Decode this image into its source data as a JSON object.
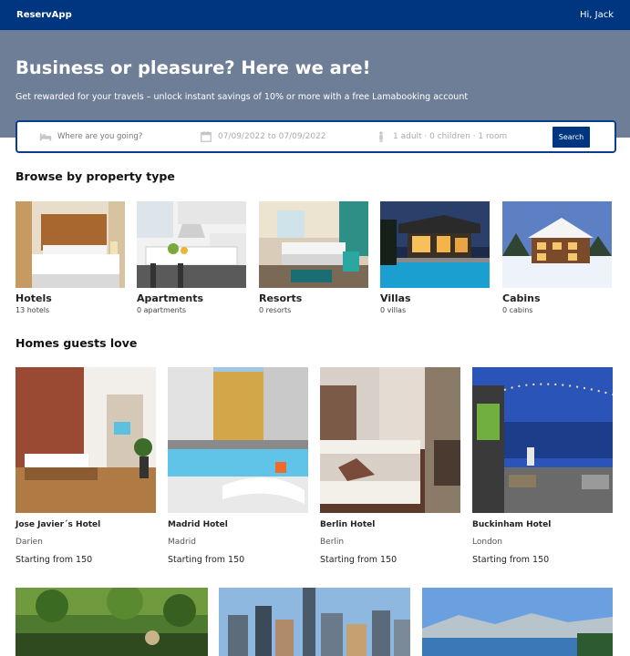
{
  "navbar": {
    "brand": "ReservApp",
    "greeting": "Hi, Jack"
  },
  "hero": {
    "title": "Business or pleasure? Here we are!",
    "subtitle": "Get rewarded for your travels – unlock instant savings of 10% or more with a free Lamabooking account"
  },
  "search": {
    "destination_placeholder": "Where are you going?",
    "dates": "07/09/2022 to 07/09/2022",
    "guests": "1 adult · 0 children · 1 room",
    "button": "Search"
  },
  "sections": {
    "browse_title": "Browse by property type",
    "homes_title": "Homes guests love"
  },
  "property_types": [
    {
      "title": "Hotels",
      "count": "13 hotels"
    },
    {
      "title": "Apartments",
      "count": "0 apartments"
    },
    {
      "title": "Resorts",
      "count": "0 resorts"
    },
    {
      "title": "Villas",
      "count": "0 villas"
    },
    {
      "title": "Cabins",
      "count": "0 cabins"
    }
  ],
  "homes": [
    {
      "name": "Jose Javier´s Hotel",
      "city": "Darien",
      "price": "Starting from 150"
    },
    {
      "name": "Madrid Hotel",
      "city": "Madrid",
      "price": "Starting from 150"
    },
    {
      "name": "Berlin Hotel",
      "city": "Berlin",
      "price": "Starting from 150"
    },
    {
      "name": "Buckinham Hotel",
      "city": "London",
      "price": "Starting from 150"
    }
  ],
  "colors": {
    "brand": "#003580",
    "hero_bg": "#6f7e97",
    "search_border": "#0a3d91"
  },
  "icons": {
    "destination": "bed-icon",
    "dates": "calendar-icon",
    "guests": "person-icon"
  }
}
